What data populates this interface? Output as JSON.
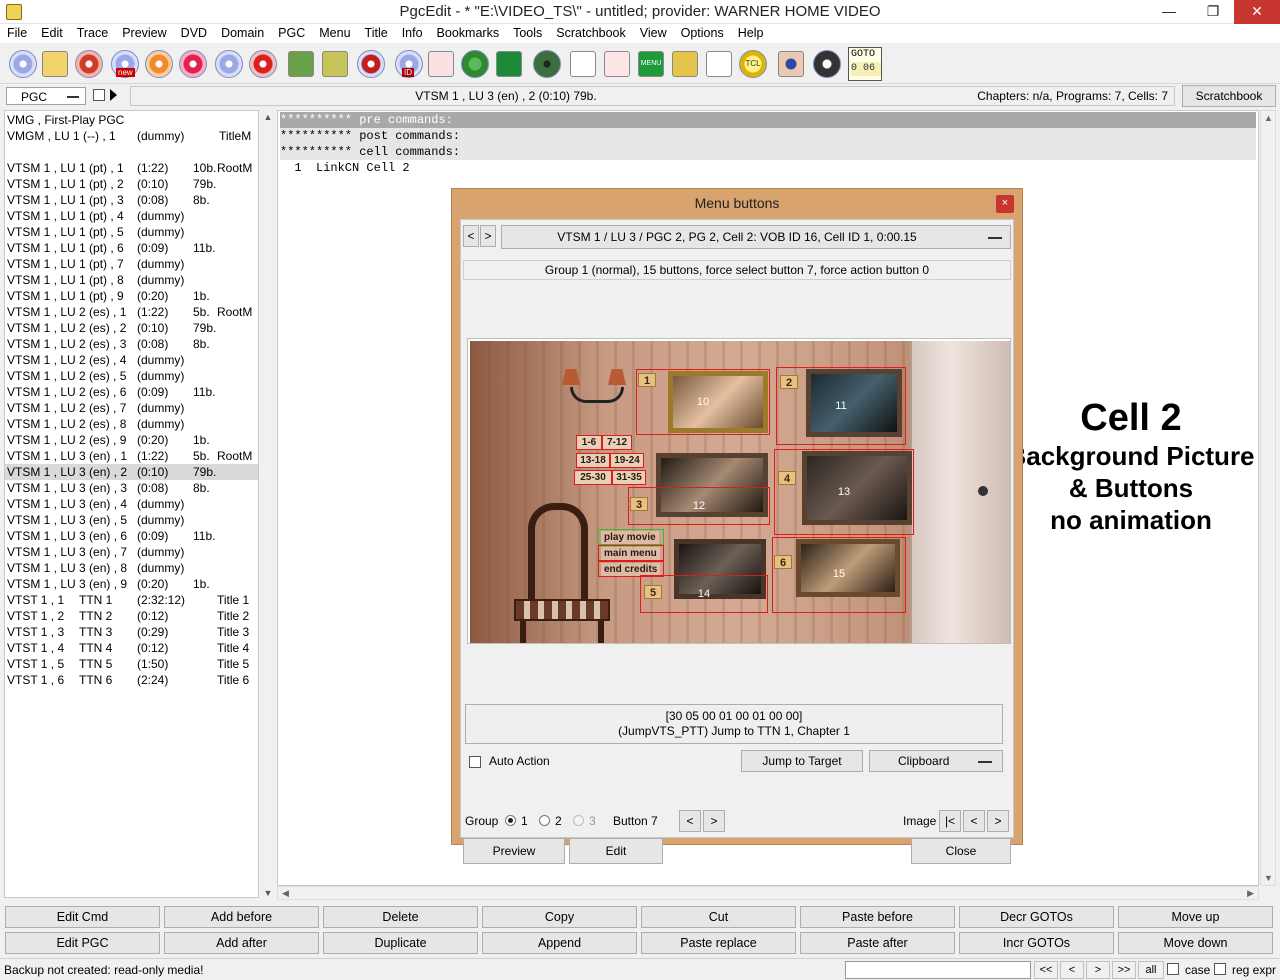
{
  "window": {
    "title": "PgcEdit - * \"E:\\VIDEO_TS\\\" - untitled; provider: WARNER HOME VIDEO",
    "minimize": "—",
    "maximize": "❐",
    "close": "✕"
  },
  "menu": [
    "File",
    "Edit",
    "Trace",
    "Preview",
    "DVD",
    "Domain",
    "PGC",
    "Menu",
    "Title",
    "Info",
    "Bookmarks",
    "Tools",
    "Scratchbook",
    "View",
    "Options",
    "Help"
  ],
  "toolbar": {
    "goto_label": "GOTO",
    "goto_value": "0  06",
    "menu_icon_label": "MENU",
    "tcl_icon_label": "TCL",
    "new_icon_label": "new",
    "id_icon_label": "ID"
  },
  "pgc_combo": "PGC",
  "infobar": {
    "center": "VTSM 1 , LU 3 (en) , 2  (0:10)  79b.",
    "right": "Chapters: n/a,  Programs: 7,  Cells: 7"
  },
  "scratchbook_button": "Scratchbook",
  "pgc_list": [
    [
      "VMG , First-Play PGC",
      "",
      "",
      ""
    ],
    [
      "VMGM , LU 1 (--) , 1",
      "(dummy)",
      "",
      "TitleM"
    ],
    [
      "",
      "",
      "",
      ""
    ],
    [
      "VTSM 1 , LU 1 (pt) , 1",
      "(1:22)",
      "10b.",
      "RootM"
    ],
    [
      "VTSM 1 , LU 1 (pt) , 2",
      "(0:10)",
      "79b.",
      ""
    ],
    [
      "VTSM 1 , LU 1 (pt) , 3",
      "(0:08)",
      "8b.",
      ""
    ],
    [
      "VTSM 1 , LU 1 (pt) , 4",
      "(dummy)",
      "",
      ""
    ],
    [
      "VTSM 1 , LU 1 (pt) , 5",
      "(dummy)",
      "",
      ""
    ],
    [
      "VTSM 1 , LU 1 (pt) , 6",
      "(0:09)",
      "11b.",
      ""
    ],
    [
      "VTSM 1 , LU 1 (pt) , 7",
      "(dummy)",
      "",
      ""
    ],
    [
      "VTSM 1 , LU 1 (pt) , 8",
      "(dummy)",
      "",
      ""
    ],
    [
      "VTSM 1 , LU 1 (pt) , 9",
      "(0:20)",
      "1b.",
      ""
    ],
    [
      "VTSM 1 , LU 2 (es) , 1",
      "(1:22)",
      "5b.",
      "RootM"
    ],
    [
      "VTSM 1 , LU 2 (es) , 2",
      "(0:10)",
      "79b.",
      ""
    ],
    [
      "VTSM 1 , LU 2 (es) , 3",
      "(0:08)",
      "8b.",
      ""
    ],
    [
      "VTSM 1 , LU 2 (es) , 4",
      "(dummy)",
      "",
      ""
    ],
    [
      "VTSM 1 , LU 2 (es) , 5",
      "(dummy)",
      "",
      ""
    ],
    [
      "VTSM 1 , LU 2 (es) , 6",
      "(0:09)",
      "11b.",
      ""
    ],
    [
      "VTSM 1 , LU 2 (es) , 7",
      "(dummy)",
      "",
      ""
    ],
    [
      "VTSM 1 , LU 2 (es) , 8",
      "(dummy)",
      "",
      ""
    ],
    [
      "VTSM 1 , LU 2 (es) , 9",
      "(0:20)",
      "1b.",
      ""
    ],
    [
      "VTSM 1 , LU 3 (en) , 1",
      "(1:22)",
      "5b.",
      "RootM"
    ],
    [
      "VTSM 1 , LU 3 (en) , 2",
      "(0:10)",
      "79b.",
      ""
    ],
    [
      "VTSM 1 , LU 3 (en) , 3",
      "(0:08)",
      "8b.",
      ""
    ],
    [
      "VTSM 1 , LU 3 (en) , 4",
      "(dummy)",
      "",
      ""
    ],
    [
      "VTSM 1 , LU 3 (en) , 5",
      "(dummy)",
      "",
      ""
    ],
    [
      "VTSM 1 , LU 3 (en) , 6",
      "(0:09)",
      "11b.",
      ""
    ],
    [
      "VTSM 1 , LU 3 (en) , 7",
      "(dummy)",
      "",
      ""
    ],
    [
      "VTSM 1 , LU 3 (en) , 8",
      "(dummy)",
      "",
      ""
    ],
    [
      "VTSM 1 , LU 3 (en) , 9",
      "(0:20)",
      "1b.",
      ""
    ],
    [
      "VTST 1 , 1",
      "(2:32:12)",
      "",
      "Title 1"
    ],
    [
      "VTST 1 , 2",
      "(0:12)",
      "",
      "Title 2"
    ],
    [
      "VTST 1 , 3",
      "(0:29)",
      "",
      "Title 3"
    ],
    [
      "VTST 1 , 4",
      "(0:12)",
      "",
      "Title 4"
    ],
    [
      "VTST 1 , 5",
      "(1:50)",
      "",
      "Title 5"
    ],
    [
      "VTST 1 , 6",
      "(2:24)",
      "",
      "Title 6"
    ]
  ],
  "pgc_list_ttn": [
    "TTN 1",
    "TTN 2",
    "TTN 3",
    "TTN 4",
    "TTN 5",
    "TTN 6"
  ],
  "selected_row": 22,
  "commands": [
    "********** pre commands:",
    "********** post commands:",
    "********** cell commands:",
    "  1  LinkCN Cell 2"
  ],
  "overlay": {
    "line1": "Cell 2",
    "line2": "Background Picture",
    "line3": "& Buttons",
    "line4": "no animation"
  },
  "dialog": {
    "title": "Menu buttons",
    "close": "×",
    "prev": "<",
    "next": ">",
    "cell": "VTSM 1 / LU 3 / PGC 2, PG 2, Cell 2: VOB ID 16, Cell ID 1, 0:00.15",
    "group_info": "Group 1 (normal), 15 buttons, force select button 7, force action button 0",
    "hotspots": [
      "10",
      "11",
      "12",
      "13",
      "14",
      "15"
    ],
    "tags": [
      "1",
      "2",
      "3",
      "4",
      "5",
      "6"
    ],
    "menu_items": [
      "play movie",
      "main menu",
      "end credits"
    ],
    "chapter_ranges": [
      "1-6",
      "7-12",
      "13-18",
      "19-24",
      "25-30",
      "31-35"
    ],
    "command_hex": "[30 05 00 01 00 01 00 00]",
    "command_text": "(JumpVTS_PTT) Jump to TTN 1, Chapter 1",
    "auto_action": "Auto Action",
    "jump_to_target": "Jump to Target",
    "clipboard": "Clipboard",
    "group_label": "Group",
    "groups": [
      "1",
      "2",
      "3"
    ],
    "button_label": "Button 7",
    "image_label": "Image",
    "image_first": "|<",
    "preview": "Preview",
    "edit": "Edit",
    "close_button": "Close"
  },
  "bottom_buttons": [
    [
      "Edit Cmd",
      "Add before",
      "Delete",
      "Copy",
      "Cut",
      "Paste before",
      "Decr GOTOs",
      "Move up"
    ],
    [
      "Edit PGC",
      "Add after",
      "Duplicate",
      "Append",
      "Paste replace",
      "Paste after",
      "Incr GOTOs",
      "Move down"
    ]
  ],
  "status": {
    "text": "Backup not created: read-only media!",
    "search_value": "",
    "nav": [
      "<<",
      "<",
      ">",
      ">>"
    ],
    "all": "all",
    "case": "case",
    "regexpr": "reg expr"
  }
}
